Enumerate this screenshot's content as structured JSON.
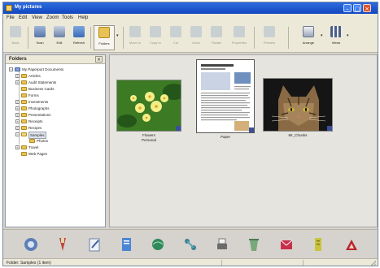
{
  "window": {
    "title": "My pictures"
  },
  "menubar": {
    "items": [
      "File",
      "Edit",
      "View",
      "Zoom",
      "Tools",
      "Help"
    ]
  },
  "toolbar": {
    "buttons": [
      {
        "label": "Back",
        "icon": "back-icon",
        "enabled": false
      },
      {
        "label": "Scan",
        "icon": "scanner-icon",
        "enabled": true
      },
      {
        "label": "Edit",
        "icon": "edit-icon",
        "enabled": true
      },
      {
        "label": "Refresh",
        "icon": "refresh-icon",
        "enabled": true
      },
      {
        "label": "Folders",
        "icon": "folders-icon",
        "enabled": true,
        "selected": true
      },
      {
        "label": "Move to",
        "icon": "move-icon",
        "enabled": false
      },
      {
        "label": "Copy to",
        "icon": "copy-icon",
        "enabled": false
      },
      {
        "label": "Cut",
        "icon": "cut-icon",
        "enabled": false
      },
      {
        "label": "Undo",
        "icon": "undo-icon",
        "enabled": false
      },
      {
        "label": "Rotate",
        "icon": "rotate-icon",
        "enabled": false
      },
      {
        "label": "Properties",
        "icon": "properties-icon",
        "enabled": false
      },
      {
        "label": "Preview",
        "icon": "preview-icon",
        "enabled": false
      },
      {
        "label": "Arrange",
        "icon": "arrange-icon",
        "enabled": true
      },
      {
        "label": "Views",
        "icon": "views-icon",
        "enabled": true
      }
    ]
  },
  "folders_pane": {
    "title": "Folders",
    "close_glyph": "×",
    "tree": [
      {
        "label": "My Paperport Documents",
        "depth": 0,
        "expander": "−"
      },
      {
        "label": "Articles",
        "depth": 1,
        "expander": "+"
      },
      {
        "label": "Audit Statements",
        "depth": 1,
        "expander": "+"
      },
      {
        "label": "Business Cards",
        "depth": 1,
        "expander": ""
      },
      {
        "label": "Forms",
        "depth": 1,
        "expander": ""
      },
      {
        "label": "Investments",
        "depth": 1,
        "expander": "+"
      },
      {
        "label": "Photographs",
        "depth": 1,
        "expander": "+"
      },
      {
        "label": "Presentations",
        "depth": 1,
        "expander": "+"
      },
      {
        "label": "Receipts",
        "depth": 1,
        "expander": "+"
      },
      {
        "label": "Recipes",
        "depth": 1,
        "expander": "+"
      },
      {
        "label": "Samples",
        "depth": 1,
        "expander": "−",
        "selected": true
      },
      {
        "label": "Photos",
        "depth": 2,
        "expander": ""
      },
      {
        "label": "Travel",
        "depth": 1,
        "expander": "+"
      },
      {
        "label": "Web Pages",
        "depth": 1,
        "expander": ""
      }
    ]
  },
  "content": {
    "items": [
      {
        "caption_line1": "Flowers",
        "caption_line2": "Personal",
        "kind": "flowers-photo",
        "selected": false
      },
      {
        "caption_line1": "Paper",
        "caption_line2": "",
        "kind": "document",
        "selected": true
      },
      {
        "caption_line1": "Mr_Chunks",
        "caption_line2": "",
        "kind": "cat-photo",
        "selected": false
      }
    ]
  },
  "send_to_bar": {
    "items": [
      {
        "icon": "scanner-app-icon"
      },
      {
        "icon": "print-app-icon"
      },
      {
        "icon": "notepad-app-icon"
      },
      {
        "icon": "document-app-icon"
      },
      {
        "icon": "browser-app-icon"
      },
      {
        "icon": "network-app-icon"
      },
      {
        "icon": "printer-app-icon"
      },
      {
        "icon": "recycle-app-icon"
      },
      {
        "icon": "mail-app-icon"
      },
      {
        "icon": "notes-app-icon"
      },
      {
        "icon": "acrobat-app-icon"
      }
    ]
  },
  "statusbar": {
    "text": "Folder: Samples (1 item)"
  },
  "colors": {
    "title_bar": "#1d56d0",
    "toolbar": "#ece9d8",
    "content_bg": "#e6e4df",
    "folder_yellow": "#e8c255"
  }
}
